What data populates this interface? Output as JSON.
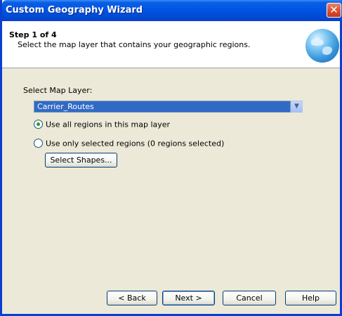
{
  "window": {
    "title": "Custom Geography Wizard",
    "close_glyph": "✕"
  },
  "header": {
    "step": "Step 1 of 4",
    "description": "Select the map layer that contains your geographic regions."
  },
  "form": {
    "layer_label": "Select Map Layer:",
    "layer_value": "Carrier_Routes",
    "radio_all_label": "Use all regions in this map layer",
    "radio_selected_label": "Use only selected regions (0 regions selected)",
    "radio_all_checked": true,
    "select_shapes_label": "Select Shapes..."
  },
  "footer": {
    "back_label": "< Back",
    "next_label": "Next >",
    "cancel_label": "Cancel",
    "help_label": "Help"
  },
  "colors": {
    "title_bar": "#0054e3",
    "dialog_bg": "#ece9d8",
    "selection": "#316ac5"
  }
}
